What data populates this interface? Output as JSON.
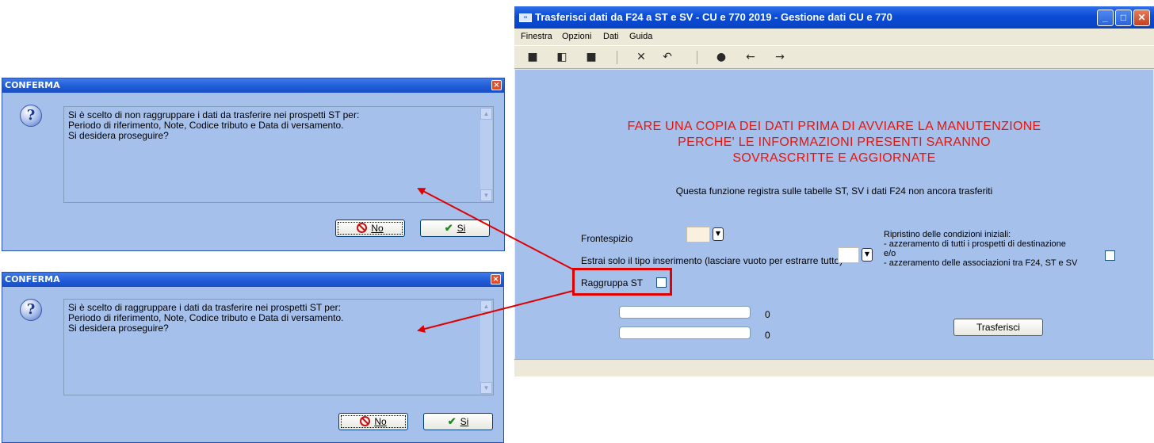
{
  "dialog1": {
    "title": "CONFERMA",
    "lines": [
      "Si è scelto di non raggruppare i dati da trasferire nei prospetti ST per:",
      "Periodo di riferimento, Note, Codice tributo e Data di versamento.",
      "Si desidera proseguire?"
    ],
    "no_label": "No",
    "yes_label": "Si"
  },
  "dialog2": {
    "title": "CONFERMA",
    "lines": [
      "Si è scelto di raggruppare i dati da trasferire nei prospetti ST per:",
      "Periodo di riferimento, Note, Codice tributo e Data di versamento.",
      "Si desidera proseguire?"
    ],
    "no_label": "No",
    "yes_label": "Si"
  },
  "main": {
    "title": "Trasferisci dati da F24 a ST e SV - CU e 770 2019 - Gestione dati CU e 770",
    "menu": [
      "Finestra",
      "Opzioni",
      "Dati",
      "Guida"
    ],
    "toolbar_icons": [
      "new-icon",
      "save-as-icon",
      "save-icon",
      "delete-icon",
      "undo-icon",
      "search-icon",
      "previous-icon",
      "next-icon"
    ],
    "warning": [
      "FARE UNA COPIA DEI DATI PRIMA DI AVVIARE LA MANUTENZIONE",
      "PERCHE' LE INFORMAZIONI PRESENTI SARANNO",
      "SOVRASCRITTE E AGGIORNATE"
    ],
    "info": "Questa funzione registra sulle tabelle ST, SV i dati F24 non ancora trasferiti",
    "frontespizio_label": "Frontespizio",
    "estrai_label": "Estrai solo il tipo inserimento (lasciare vuoto per estrarre tutto)",
    "raggruppa_label": "Raggruppa ST",
    "ripristino": [
      "Ripristino delle condizioni iniziali:",
      "- azzeramento di tutti i prospetti di destinazione",
      "e/o",
      "- azzeramento delle associazioni tra F24, ST e SV"
    ],
    "progress1_value": "0",
    "progress2_value": "0",
    "transfer_button": "Trasferisci"
  },
  "colors": {
    "dialog_bg": "#a6c0ec",
    "warning_text": "#e8140a",
    "annotation": "#e00000"
  }
}
